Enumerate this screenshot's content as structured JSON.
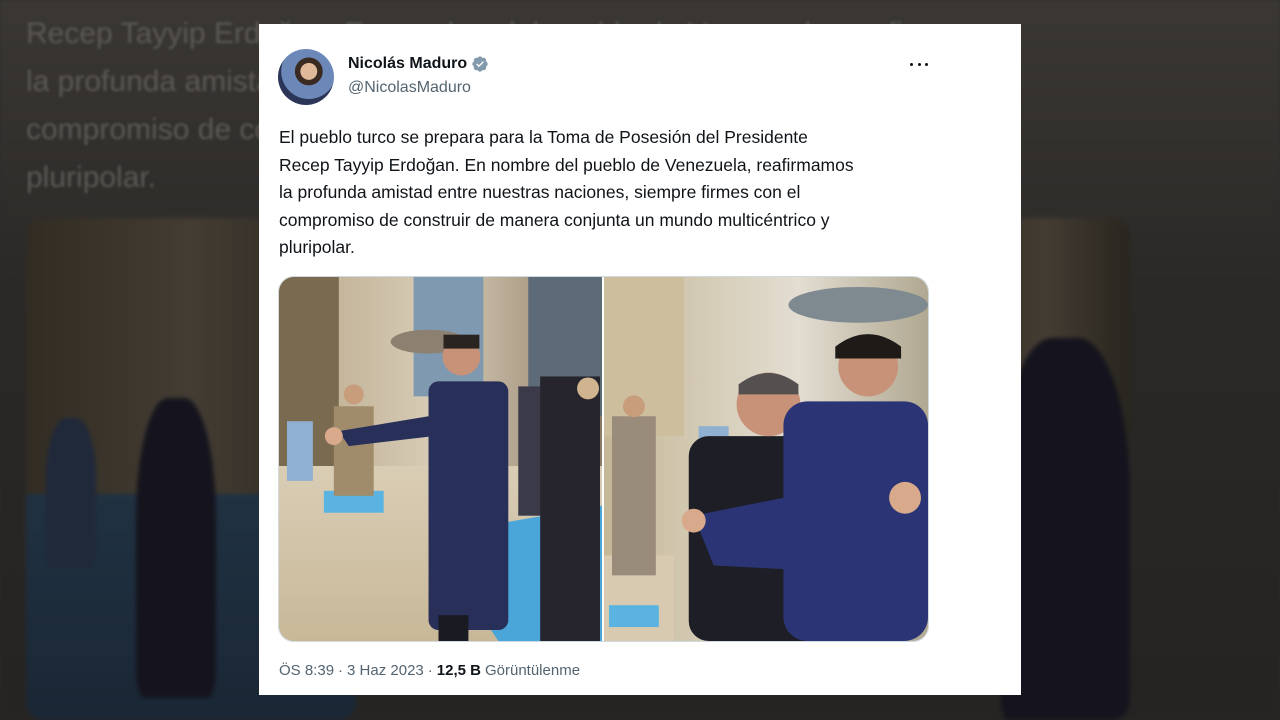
{
  "tweet": {
    "author": {
      "display_name": "Nicolás Maduro",
      "handle": "@NicolasMaduro",
      "verified": true
    },
    "text": "El pueblo turco se prepara para la Toma de Posesión del Presidente\nRecep Tayyip Erdoğan. En nombre del pueblo de Venezuela, reafirmamos\nla profunda amistad entre nuestras naciones, siempre firmes con el\ncompromiso de construir de manera conjunta un mundo multicéntrico y\npluripolar.",
    "time": "ÖS 8:39",
    "date": "3 Haz 2023",
    "views_count": "12,5 B",
    "views_label": "Görüntülenme",
    "separator": "·"
  },
  "background": {
    "echo_text": "Recep Tayyip Erdoğan. En nombre del pueblo de Venezuela, reafirmamos\nla profunda amistad entre nuestras naciones, siempre firmes con el\ncompromiso de construir de manera conjunta un mundo multicéntrico y\npluripolar."
  },
  "colors": {
    "card_bg": "#ffffff",
    "text_primary": "#0f1419",
    "text_secondary": "#536471",
    "verified_badge": "#829aab",
    "backdrop": "#2d2b29"
  },
  "icons": {
    "verified": "verified-badge-icon",
    "more": "more-options-icon"
  }
}
